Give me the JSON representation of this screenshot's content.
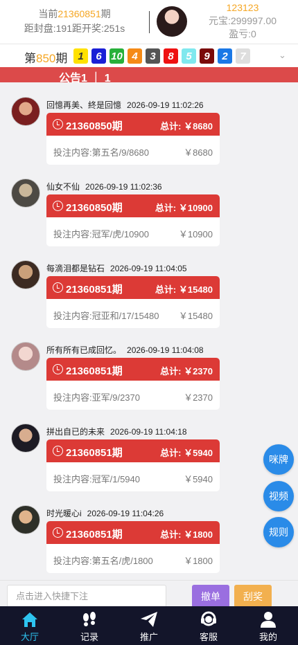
{
  "header": {
    "current_label": "当前",
    "current_issue": "21360851",
    "current_suffix": "期",
    "countdown": "距封盘:191距开奖:251s",
    "user_id": "123123",
    "balance": "元宝:299997.00",
    "profit": "盈亏:0"
  },
  "result": {
    "prefix": "第",
    "issue": "850",
    "suffix": "期",
    "balls": [
      {
        "n": "1",
        "color": "#ffe100",
        "text": "#333"
      },
      {
        "n": "6",
        "color": "#1a1fd6",
        "text": "#fff"
      },
      {
        "n": "10",
        "color": "#27b03a",
        "text": "#fff"
      },
      {
        "n": "4",
        "color": "#f58a16",
        "text": "#fff"
      },
      {
        "n": "3",
        "color": "#555555",
        "text": "#fff"
      },
      {
        "n": "8",
        "color": "#ee1111",
        "text": "#fff"
      },
      {
        "n": "5",
        "color": "#7fe8ee",
        "text": "#fff"
      },
      {
        "n": "9",
        "color": "#7a0a0a",
        "text": "#fff"
      },
      {
        "n": "2",
        "color": "#1a78e6",
        "text": "#fff"
      },
      {
        "n": "7",
        "color": "#dedede",
        "text": "#fff"
      }
    ]
  },
  "notice": "公告1 ｜ 1",
  "posts": [
    {
      "user": "回憶再美、終是回憶",
      "time": "2026-09-19 11:02:26",
      "issue": "21360850期",
      "total": "总计: ￥8680",
      "content": "投注内容:第五名/9/8680",
      "amount": "￥8680"
    },
    {
      "user": "仙女不仙",
      "time": "2026-09-19 11:02:36",
      "issue": "21360850期",
      "total": "总计: ￥10900",
      "content": "投注内容:冠军/虎/10900",
      "amount": "￥10900"
    },
    {
      "user": "每滴泪都是钻石",
      "time": "2026-09-19 11:04:05",
      "issue": "21360851期",
      "total": "总计: ￥15480",
      "content": "投注内容:冠亚和/17/15480",
      "amount": "￥15480"
    },
    {
      "user": "所有所有已成回忆。",
      "time": "2026-09-19 11:04:08",
      "issue": "21360851期",
      "total": "总计: ￥2370",
      "content": "投注内容:亚军/9/2370",
      "amount": "￥2370"
    },
    {
      "user": "拼出自已的未来",
      "time": "2026-09-19 11:04:18",
      "issue": "21360851期",
      "total": "总计: ￥5940",
      "content": "投注内容:冠军/1/5940",
      "amount": "￥5940"
    },
    {
      "user": "时光暖心i",
      "time": "2026-09-19 11:04:26",
      "issue": "21360851期",
      "total": "总计: ￥1800",
      "content": "投注内容:第五名/虎/1800",
      "amount": "￥1800"
    }
  ],
  "fabs": [
    "咪牌",
    "视频",
    "规则"
  ],
  "quick": {
    "placeholder": "点击进入快捷下注",
    "cancel": "撤单",
    "scratch": "刮奖"
  },
  "tabs": [
    {
      "label": "大厅",
      "icon": "home-icon"
    },
    {
      "label": "记录",
      "icon": "footprint-icon"
    },
    {
      "label": "推广",
      "icon": "paper-plane-icon"
    },
    {
      "label": "客服",
      "icon": "headset-icon"
    },
    {
      "label": "我的",
      "icon": "user-icon"
    }
  ],
  "colors": {
    "accent": "#f5a623",
    "card_red": "#dc3a36",
    "fab_blue": "#2a8be8",
    "tabbar": "#13152a",
    "active_tab": "#2ec4f0"
  }
}
